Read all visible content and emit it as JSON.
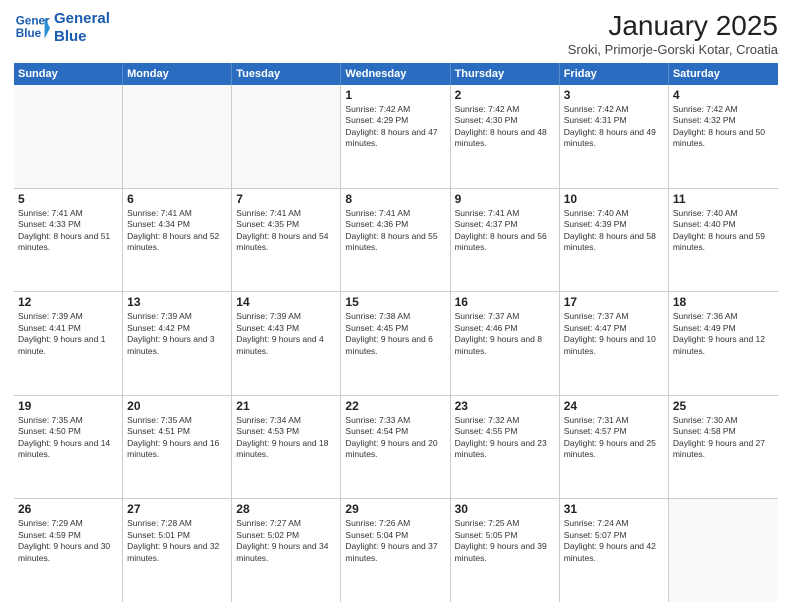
{
  "logo": {
    "line1": "General",
    "line2": "Blue"
  },
  "title": "January 2025",
  "subtitle": "Sroki, Primorje-Gorski Kotar, Croatia",
  "days": [
    "Sunday",
    "Monday",
    "Tuesday",
    "Wednesday",
    "Thursday",
    "Friday",
    "Saturday"
  ],
  "weeks": [
    [
      {
        "day": "",
        "content": ""
      },
      {
        "day": "",
        "content": ""
      },
      {
        "day": "",
        "content": ""
      },
      {
        "day": "1",
        "content": "Sunrise: 7:42 AM\nSunset: 4:29 PM\nDaylight: 8 hours and 47 minutes."
      },
      {
        "day": "2",
        "content": "Sunrise: 7:42 AM\nSunset: 4:30 PM\nDaylight: 8 hours and 48 minutes."
      },
      {
        "day": "3",
        "content": "Sunrise: 7:42 AM\nSunset: 4:31 PM\nDaylight: 8 hours and 49 minutes."
      },
      {
        "day": "4",
        "content": "Sunrise: 7:42 AM\nSunset: 4:32 PM\nDaylight: 8 hours and 50 minutes."
      }
    ],
    [
      {
        "day": "5",
        "content": "Sunrise: 7:41 AM\nSunset: 4:33 PM\nDaylight: 8 hours and 51 minutes."
      },
      {
        "day": "6",
        "content": "Sunrise: 7:41 AM\nSunset: 4:34 PM\nDaylight: 8 hours and 52 minutes."
      },
      {
        "day": "7",
        "content": "Sunrise: 7:41 AM\nSunset: 4:35 PM\nDaylight: 8 hours and 54 minutes."
      },
      {
        "day": "8",
        "content": "Sunrise: 7:41 AM\nSunset: 4:36 PM\nDaylight: 8 hours and 55 minutes."
      },
      {
        "day": "9",
        "content": "Sunrise: 7:41 AM\nSunset: 4:37 PM\nDaylight: 8 hours and 56 minutes."
      },
      {
        "day": "10",
        "content": "Sunrise: 7:40 AM\nSunset: 4:39 PM\nDaylight: 8 hours and 58 minutes."
      },
      {
        "day": "11",
        "content": "Sunrise: 7:40 AM\nSunset: 4:40 PM\nDaylight: 8 hours and 59 minutes."
      }
    ],
    [
      {
        "day": "12",
        "content": "Sunrise: 7:39 AM\nSunset: 4:41 PM\nDaylight: 9 hours and 1 minute."
      },
      {
        "day": "13",
        "content": "Sunrise: 7:39 AM\nSunset: 4:42 PM\nDaylight: 9 hours and 3 minutes."
      },
      {
        "day": "14",
        "content": "Sunrise: 7:39 AM\nSunset: 4:43 PM\nDaylight: 9 hours and 4 minutes."
      },
      {
        "day": "15",
        "content": "Sunrise: 7:38 AM\nSunset: 4:45 PM\nDaylight: 9 hours and 6 minutes."
      },
      {
        "day": "16",
        "content": "Sunrise: 7:37 AM\nSunset: 4:46 PM\nDaylight: 9 hours and 8 minutes."
      },
      {
        "day": "17",
        "content": "Sunrise: 7:37 AM\nSunset: 4:47 PM\nDaylight: 9 hours and 10 minutes."
      },
      {
        "day": "18",
        "content": "Sunrise: 7:36 AM\nSunset: 4:49 PM\nDaylight: 9 hours and 12 minutes."
      }
    ],
    [
      {
        "day": "19",
        "content": "Sunrise: 7:35 AM\nSunset: 4:50 PM\nDaylight: 9 hours and 14 minutes."
      },
      {
        "day": "20",
        "content": "Sunrise: 7:35 AM\nSunset: 4:51 PM\nDaylight: 9 hours and 16 minutes."
      },
      {
        "day": "21",
        "content": "Sunrise: 7:34 AM\nSunset: 4:53 PM\nDaylight: 9 hours and 18 minutes."
      },
      {
        "day": "22",
        "content": "Sunrise: 7:33 AM\nSunset: 4:54 PM\nDaylight: 9 hours and 20 minutes."
      },
      {
        "day": "23",
        "content": "Sunrise: 7:32 AM\nSunset: 4:55 PM\nDaylight: 9 hours and 23 minutes."
      },
      {
        "day": "24",
        "content": "Sunrise: 7:31 AM\nSunset: 4:57 PM\nDaylight: 9 hours and 25 minutes."
      },
      {
        "day": "25",
        "content": "Sunrise: 7:30 AM\nSunset: 4:58 PM\nDaylight: 9 hours and 27 minutes."
      }
    ],
    [
      {
        "day": "26",
        "content": "Sunrise: 7:29 AM\nSunset: 4:59 PM\nDaylight: 9 hours and 30 minutes."
      },
      {
        "day": "27",
        "content": "Sunrise: 7:28 AM\nSunset: 5:01 PM\nDaylight: 9 hours and 32 minutes."
      },
      {
        "day": "28",
        "content": "Sunrise: 7:27 AM\nSunset: 5:02 PM\nDaylight: 9 hours and 34 minutes."
      },
      {
        "day": "29",
        "content": "Sunrise: 7:26 AM\nSunset: 5:04 PM\nDaylight: 9 hours and 37 minutes."
      },
      {
        "day": "30",
        "content": "Sunrise: 7:25 AM\nSunset: 5:05 PM\nDaylight: 9 hours and 39 minutes."
      },
      {
        "day": "31",
        "content": "Sunrise: 7:24 AM\nSunset: 5:07 PM\nDaylight: 9 hours and 42 minutes."
      },
      {
        "day": "",
        "content": ""
      }
    ]
  ]
}
